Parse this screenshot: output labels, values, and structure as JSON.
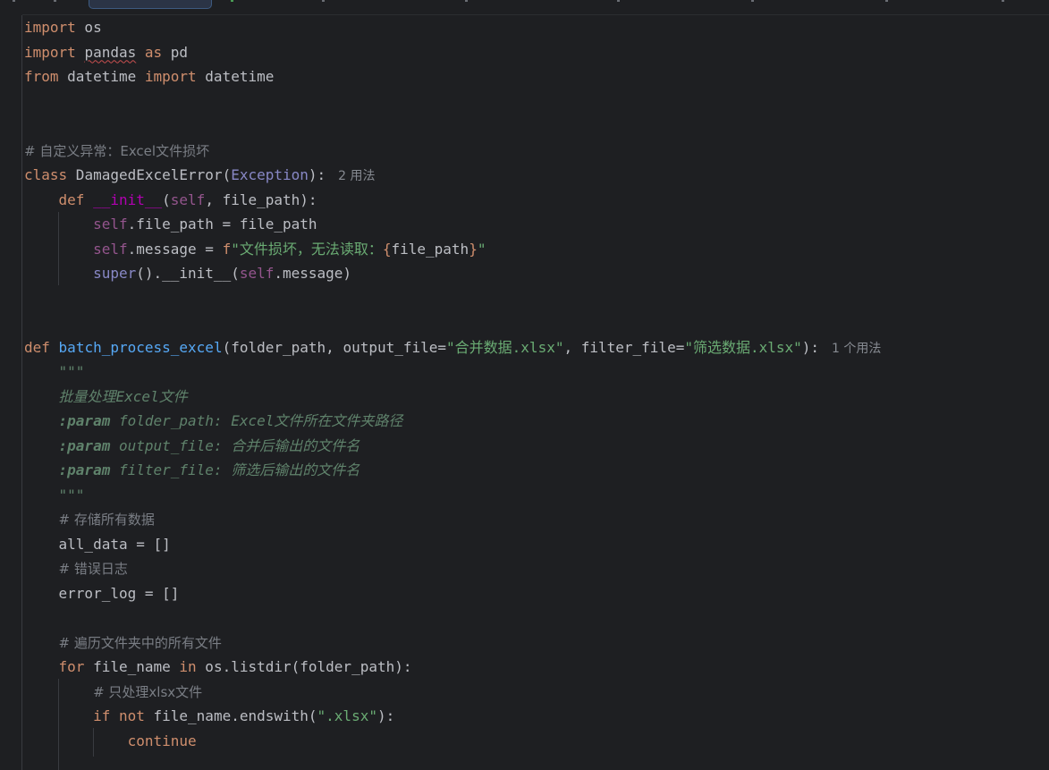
{
  "editor": {
    "language": "python",
    "lines": [
      {
        "indent": 0,
        "tokens": [
          [
            "kw",
            "import"
          ],
          [
            "t",
            " os"
          ]
        ]
      },
      {
        "indent": 0,
        "tokens": [
          [
            "kw",
            "import"
          ],
          [
            "t",
            " "
          ],
          [
            "typo",
            "pandas"
          ],
          [
            "t",
            " "
          ],
          [
            "kw",
            "as"
          ],
          [
            "t",
            " pd"
          ]
        ]
      },
      {
        "indent": 0,
        "tokens": [
          [
            "kw",
            "from"
          ],
          [
            "t",
            " datetime "
          ],
          [
            "kw",
            "import"
          ],
          [
            "t",
            " datetime"
          ]
        ]
      },
      {
        "indent": 0,
        "tokens": []
      },
      {
        "indent": 0,
        "tokens": []
      },
      {
        "indent": 0,
        "tokens": [
          [
            "cm",
            "# 自定义异常：Excel文件损坏"
          ]
        ]
      },
      {
        "indent": 0,
        "tokens": [
          [
            "kw",
            "class"
          ],
          [
            "t",
            " DamagedExcelError("
          ],
          [
            "ex",
            "Exception"
          ],
          [
            "t",
            "):"
          ],
          [
            "hint",
            "2 用法"
          ]
        ]
      },
      {
        "indent": 1,
        "tokens": [
          [
            "kw",
            "def"
          ],
          [
            "t",
            " "
          ],
          [
            "mg",
            "__init__"
          ],
          [
            "t",
            "("
          ],
          [
            "slf",
            "self"
          ],
          [
            "t",
            ", file_path):"
          ]
        ]
      },
      {
        "indent": 2,
        "tokens": [
          [
            "slf",
            "self"
          ],
          [
            "t",
            ".file_path = file_path"
          ]
        ]
      },
      {
        "indent": 2,
        "tokens": [
          [
            "slf",
            "self"
          ],
          [
            "t",
            ".message = "
          ],
          [
            "kw",
            "f"
          ],
          [
            "st",
            "\"文件损坏，无法读取："
          ],
          [
            "kw",
            "{"
          ],
          [
            "t",
            "file_path"
          ],
          [
            "kw",
            "}"
          ],
          [
            "st",
            "\""
          ]
        ]
      },
      {
        "indent": 2,
        "tokens": [
          [
            "ex",
            "super"
          ],
          [
            "t",
            "().__init__("
          ],
          [
            "slf",
            "self"
          ],
          [
            "t",
            ".message)"
          ]
        ]
      },
      {
        "indent": 0,
        "tokens": []
      },
      {
        "indent": 0,
        "tokens": []
      },
      {
        "indent": 0,
        "tokens": [
          [
            "kw",
            "def"
          ],
          [
            "t",
            " "
          ],
          [
            "fn",
            "batch_process_excel"
          ],
          [
            "t",
            "(folder_path, output_file="
          ],
          [
            "st",
            "\"合并数据.xlsx\""
          ],
          [
            "t",
            ", filter_file="
          ],
          [
            "st",
            "\"筛选数据.xlsx\""
          ],
          [
            "t",
            "):"
          ],
          [
            "hint",
            "1 个用法"
          ]
        ]
      },
      {
        "indent": 1,
        "tokens": [
          [
            "doc",
            "\"\"\""
          ]
        ]
      },
      {
        "indent": 1,
        "tokens": [
          [
            "doc",
            "批量处理Excel文件"
          ]
        ]
      },
      {
        "indent": 1,
        "tokens": [
          [
            "dtag",
            ":param"
          ],
          [
            "doc",
            " folder_path: Excel文件所在文件夹路径"
          ]
        ]
      },
      {
        "indent": 1,
        "tokens": [
          [
            "dtag",
            ":param"
          ],
          [
            "doc",
            " output_file: 合并后输出的文件名"
          ]
        ]
      },
      {
        "indent": 1,
        "tokens": [
          [
            "dtag",
            ":param"
          ],
          [
            "doc",
            " filter_file: 筛选后输出的文件名"
          ]
        ]
      },
      {
        "indent": 1,
        "tokens": [
          [
            "doc",
            "\"\"\""
          ]
        ]
      },
      {
        "indent": 1,
        "tokens": [
          [
            "cm",
            "# 存储所有数据"
          ]
        ]
      },
      {
        "indent": 1,
        "tokens": [
          [
            "t",
            "all_data = []"
          ]
        ]
      },
      {
        "indent": 1,
        "tokens": [
          [
            "cm",
            "# 错误日志"
          ]
        ]
      },
      {
        "indent": 1,
        "tokens": [
          [
            "t",
            "error_log = []"
          ]
        ]
      },
      {
        "indent": 0,
        "tokens": []
      },
      {
        "indent": 1,
        "tokens": [
          [
            "cm",
            "# 遍历文件夹中的所有文件"
          ]
        ]
      },
      {
        "indent": 1,
        "tokens": [
          [
            "kw",
            "for"
          ],
          [
            "t",
            " file_name "
          ],
          [
            "kw",
            "in"
          ],
          [
            "t",
            " os.listdir(folder_path):"
          ]
        ]
      },
      {
        "indent": 2,
        "tokens": [
          [
            "cm",
            "# 只处理xlsx文件"
          ]
        ]
      },
      {
        "indent": 2,
        "tokens": [
          [
            "kw",
            "if"
          ],
          [
            "t",
            " "
          ],
          [
            "kw",
            "not"
          ],
          [
            "t",
            " file_name.endswith("
          ],
          [
            "st",
            "\".xlsx\""
          ],
          [
            "t",
            "):"
          ]
        ]
      },
      {
        "indent": 3,
        "tokens": [
          [
            "kw",
            "continue"
          ]
        ]
      }
    ]
  },
  "colors": {
    "background": "#1e1f22",
    "keyword": "#cf8e6d",
    "function": "#56a8f5",
    "string": "#6aab73",
    "comment": "#7a7e85",
    "docstring": "#5f826b",
    "self": "#94558d",
    "magic": "#b200b2",
    "builtin": "#8888c6"
  }
}
